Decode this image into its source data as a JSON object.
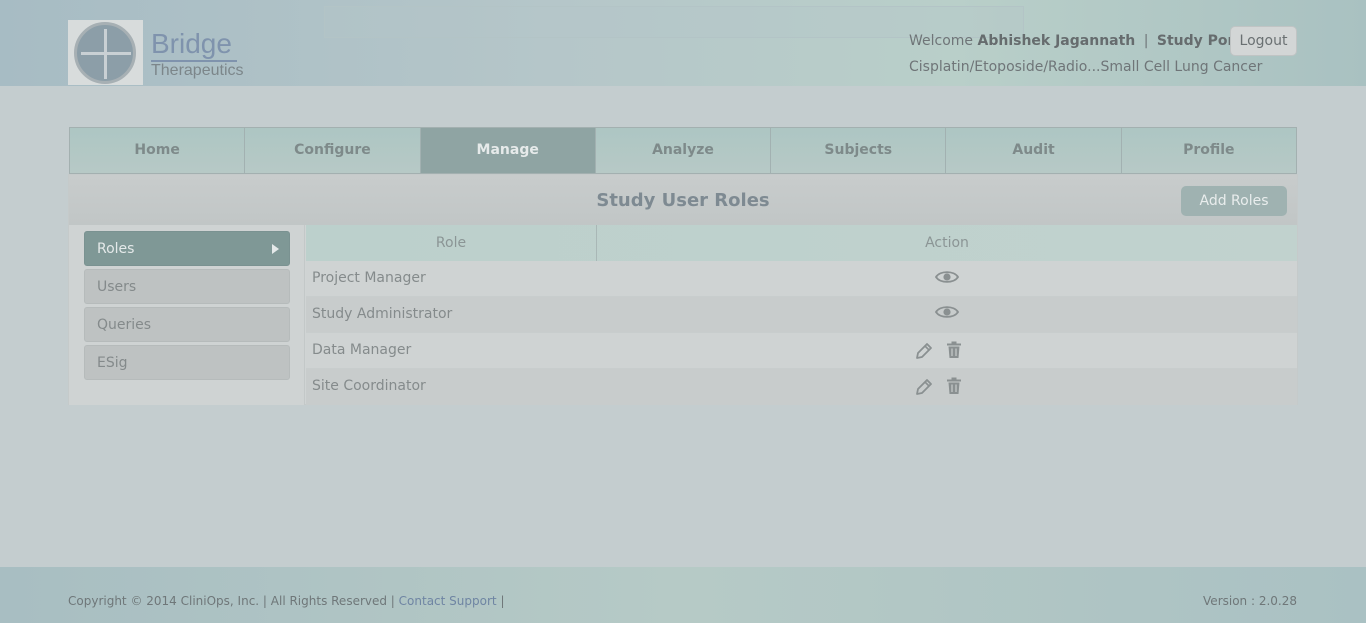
{
  "header": {
    "logo": {
      "title": "Bridge",
      "subtitle": "Therapeutics"
    },
    "welcome_prefix": "Welcome",
    "user_name": "Abhishek Jagannath",
    "separator": "|",
    "portal": "Study Portal",
    "study": "Cisplatin/Etoposide/Radio...Small Cell Lung Cancer",
    "logout_label": "Logout"
  },
  "nav": {
    "items": [
      {
        "label": "Home"
      },
      {
        "label": "Configure"
      },
      {
        "label": "Manage",
        "active": true
      },
      {
        "label": "Analyze"
      },
      {
        "label": "Subjects"
      },
      {
        "label": "Audit"
      },
      {
        "label": "Profile"
      }
    ]
  },
  "panel": {
    "title": "Study User Roles",
    "add_button": "Add Roles"
  },
  "sidebar": {
    "items": [
      {
        "label": "Roles",
        "active": true
      },
      {
        "label": "Users"
      },
      {
        "label": "Queries"
      },
      {
        "label": "ESig"
      }
    ]
  },
  "table": {
    "columns": [
      "Role",
      "Action"
    ],
    "rows": [
      {
        "role": "Project Manager",
        "actions": [
          "eye-icon"
        ]
      },
      {
        "role": "Study Administrator",
        "actions": [
          "eye-icon"
        ]
      },
      {
        "role": "Data Manager",
        "actions": [
          "pencil-icon",
          "trash-icon"
        ]
      },
      {
        "role": "Site Coordinator",
        "actions": [
          "pencil-icon",
          "trash-icon"
        ]
      }
    ]
  },
  "footer": {
    "copyright": "Copyright © 2014 CliniOps, Inc. | All Rights Reserved |",
    "support_link": "Contact Support",
    "trailing_sep": "|",
    "version": "Version : 2.0.28"
  },
  "colors": {
    "overlay": "#c4cdcf",
    "active_nav": "#8fa4a3",
    "active_side": "#7f9896",
    "link": "#6f85a3"
  }
}
